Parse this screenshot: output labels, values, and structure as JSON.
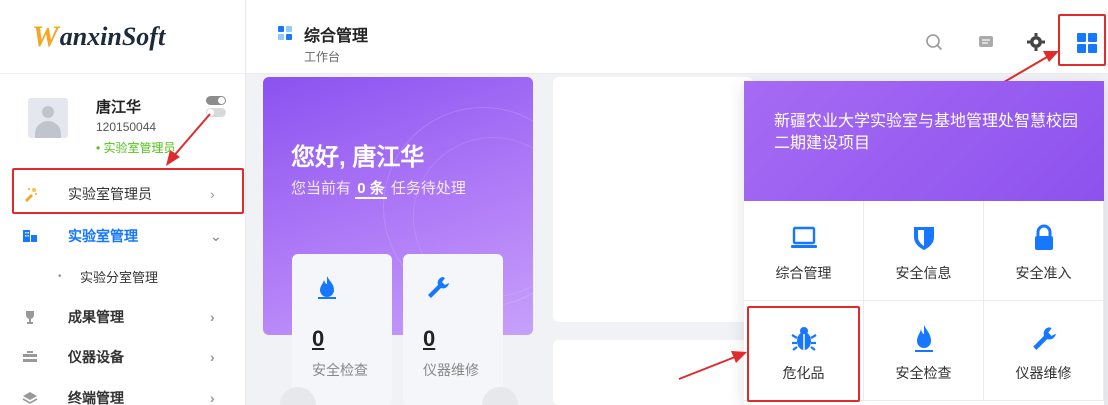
{
  "logo": {
    "w": "W",
    "rest": "anxinSoft"
  },
  "user": {
    "name": "唐江华",
    "id": "120150044",
    "role": "• 实验室管理员"
  },
  "sidebar": {
    "items": [
      {
        "label": "实验室管理员",
        "chevron": "›"
      },
      {
        "label": "实验室管理",
        "chevron": "⌄"
      },
      {
        "label": "实验分室管理",
        "bullet": "•"
      },
      {
        "label": "成果管理",
        "chevron": "›"
      },
      {
        "label": "仪器设备",
        "chevron": "›"
      },
      {
        "label": "终端管理",
        "chevron": "›"
      }
    ]
  },
  "header": {
    "title": "综合管理",
    "subtitle": "工作台"
  },
  "welcome": {
    "greeting": "您好, 唐江华",
    "tasks_prefix": "您当前有",
    "tasks_count": "0 条",
    "tasks_suffix": "任务待处理"
  },
  "stats": [
    {
      "value": "0",
      "label": "安全检查",
      "icon": "flame-icon"
    },
    {
      "value": "0",
      "label": "仪器维修",
      "icon": "wrench-icon"
    }
  ],
  "panel": {
    "title": "新疆农业大学实验室与基地管理处智慧校园二期建设项目",
    "apps": [
      {
        "label": "综合管理",
        "icon": "laptop-icon"
      },
      {
        "label": "安全信息",
        "icon": "shield-icon"
      },
      {
        "label": "安全准入",
        "icon": "lock-icon"
      },
      {
        "label": "危化品",
        "icon": "bug-icon"
      },
      {
        "label": "安全检查",
        "icon": "flame-icon"
      },
      {
        "label": "仪器维修",
        "icon": "wrench-icon"
      }
    ]
  },
  "colors": {
    "accent": "#1677ff",
    "purple": "#8b52f0",
    "highlight": "#e02b2b"
  }
}
